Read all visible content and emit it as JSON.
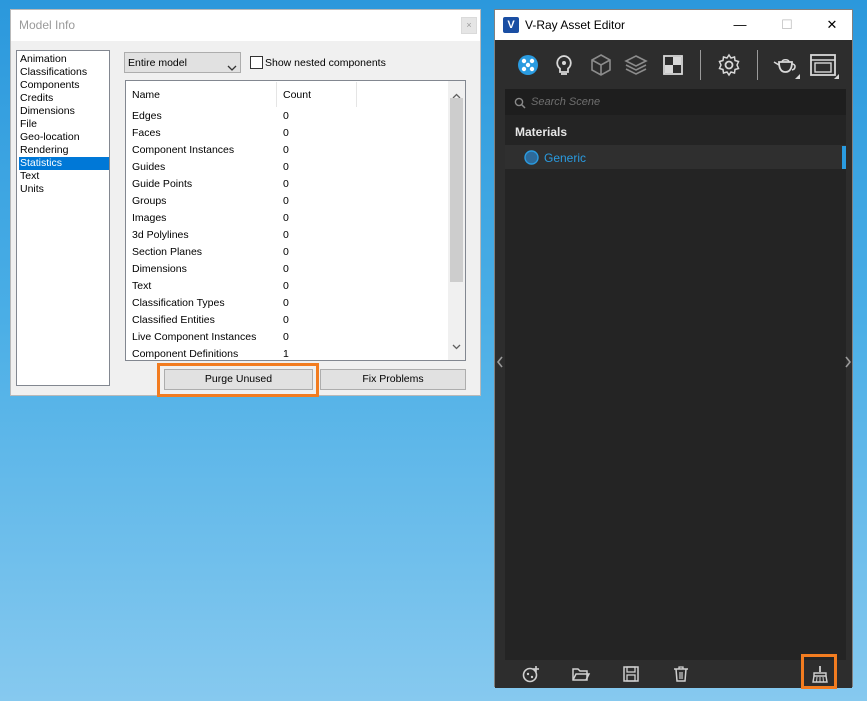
{
  "colors": {
    "desktop_top": "#2b98dc",
    "desktop_bottom": "#86c9ef",
    "accent_blue": "#2a9be0",
    "selection_blue": "#0078d7",
    "highlight_orange": "#f27c20"
  },
  "model_info": {
    "title": "Model Info",
    "sidebar": {
      "items": [
        "Animation",
        "Classifications",
        "Components",
        "Credits",
        "Dimensions",
        "File",
        "Geo-location",
        "Rendering",
        "Statistics",
        "Text",
        "Units"
      ],
      "selected": "Statistics"
    },
    "scope_select": {
      "value": "Entire model"
    },
    "show_nested": {
      "label": "Show nested components",
      "checked": false
    },
    "table": {
      "headers": {
        "name": "Name",
        "count": "Count"
      },
      "rows": [
        {
          "name": "Edges",
          "count": "0"
        },
        {
          "name": "Faces",
          "count": "0"
        },
        {
          "name": "Component Instances",
          "count": "0"
        },
        {
          "name": "Guides",
          "count": "0"
        },
        {
          "name": "Guide Points",
          "count": "0"
        },
        {
          "name": "Groups",
          "count": "0"
        },
        {
          "name": "Images",
          "count": "0"
        },
        {
          "name": "3d Polylines",
          "count": "0"
        },
        {
          "name": "Section Planes",
          "count": "0"
        },
        {
          "name": "Dimensions",
          "count": "0"
        },
        {
          "name": "Text",
          "count": "0"
        },
        {
          "name": "Classification Types",
          "count": "0"
        },
        {
          "name": "Classified Entities",
          "count": "0"
        },
        {
          "name": "Live Component Instances",
          "count": "0"
        },
        {
          "name": "Component Definitions",
          "count": "1"
        }
      ]
    },
    "buttons": {
      "purge": "Purge Unused",
      "fix": "Fix Problems"
    }
  },
  "vray": {
    "title": "V-Ray Asset Editor",
    "logo_letter": "V",
    "window_controls": {
      "minimize": "—",
      "maximize": "☐",
      "close": "✕"
    },
    "toolbar_icons": [
      "materials-icon",
      "lights-icon",
      "geometry-icon",
      "render-elements-icon",
      "textures-icon",
      "settings-icon",
      "render-teapot-icon",
      "frame-buffer-icon"
    ],
    "search": {
      "placeholder": "Search Scene",
      "value": ""
    },
    "section_label": "Materials",
    "materials": [
      {
        "name": "Generic"
      }
    ],
    "bottom_icons": [
      "add-material-icon",
      "open-file-icon",
      "save-icon",
      "delete-icon",
      "purge-unused-materials-icon"
    ]
  }
}
